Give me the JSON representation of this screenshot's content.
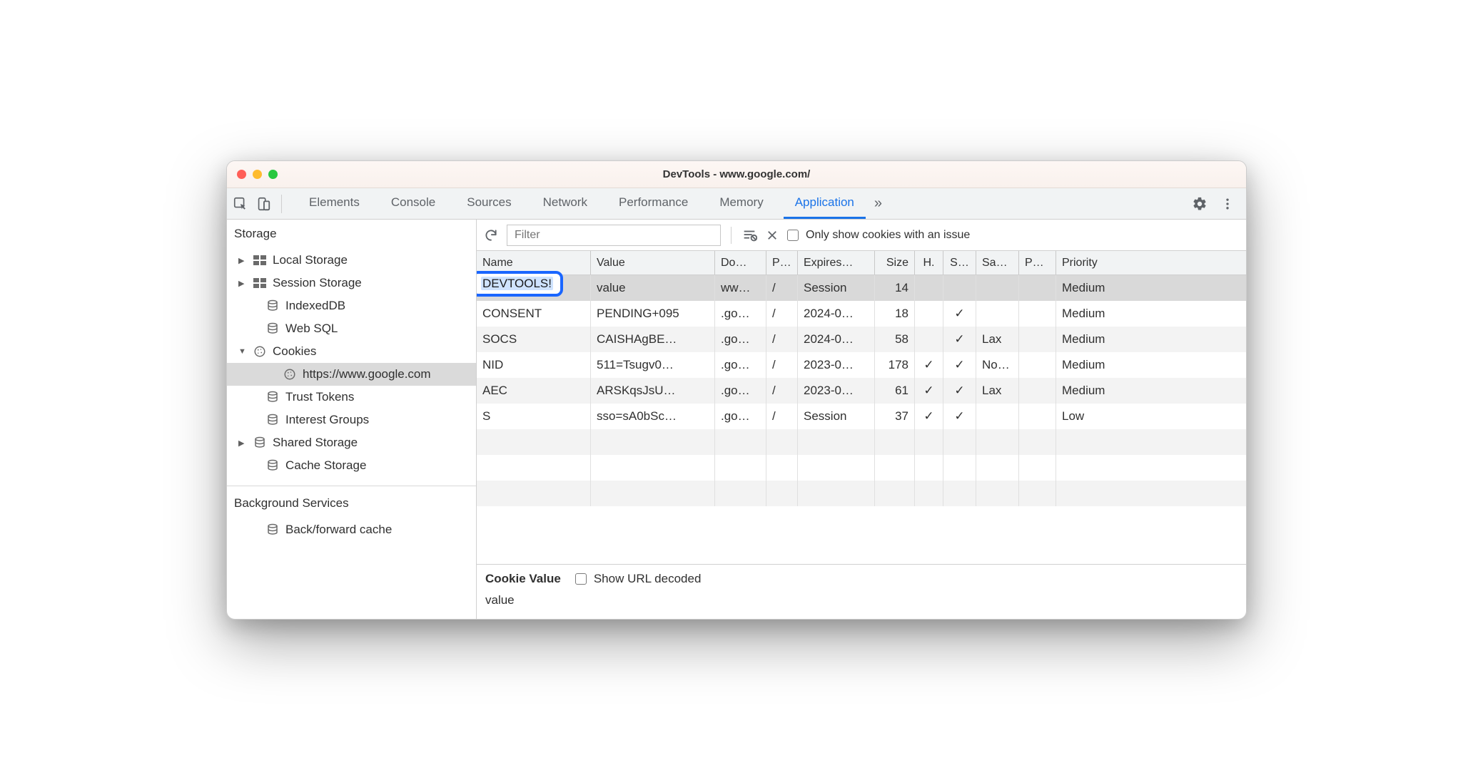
{
  "title": "DevTools - www.google.com/",
  "tabs": [
    "Elements",
    "Console",
    "Sources",
    "Network",
    "Performance",
    "Memory",
    "Application"
  ],
  "active_tab_index": 6,
  "sidebar": {
    "sections": [
      {
        "title": "Storage",
        "items": [
          {
            "arrow": "▶",
            "icon": "grid",
            "label": "Local Storage",
            "indent": 0
          },
          {
            "arrow": "▶",
            "icon": "grid",
            "label": "Session Storage",
            "indent": 0
          },
          {
            "arrow": "",
            "icon": "db",
            "label": "IndexedDB",
            "indent": 1
          },
          {
            "arrow": "",
            "icon": "db",
            "label": "Web SQL",
            "indent": 1
          },
          {
            "arrow": "▼",
            "icon": "cookie",
            "label": "Cookies",
            "indent": 0
          },
          {
            "arrow": "",
            "icon": "cookie",
            "label": "https://www.google.com",
            "indent": 2,
            "selected": true
          },
          {
            "arrow": "",
            "icon": "db",
            "label": "Trust Tokens",
            "indent": 1
          },
          {
            "arrow": "",
            "icon": "db",
            "label": "Interest Groups",
            "indent": 1
          },
          {
            "arrow": "▶",
            "icon": "db",
            "label": "Shared Storage",
            "indent": 0
          },
          {
            "arrow": "",
            "icon": "db",
            "label": "Cache Storage",
            "indent": 1
          }
        ]
      },
      {
        "title": "Background Services",
        "items": [
          {
            "arrow": "",
            "icon": "db",
            "label": "Back/forward cache",
            "indent": 1
          }
        ]
      }
    ]
  },
  "toolbar": {
    "filter_placeholder": "Filter",
    "only_issues_label": "Only show cookies with an issue"
  },
  "table": {
    "columns": [
      "Name",
      "Value",
      "Do…",
      "P…",
      "Expires…",
      "Size",
      "H.",
      "S…",
      "Sa…",
      "P…",
      "Priority"
    ],
    "editing_value": "DEVTOOLS!",
    "rows": [
      {
        "name": "",
        "value": "value",
        "domain": "ww…",
        "path": "/",
        "expires": "Session",
        "size": "14",
        "http": "",
        "secure": "",
        "samesite": "",
        "partition": "",
        "priority": "Medium",
        "selected": true
      },
      {
        "name": "CONSENT",
        "value": "PENDING+095",
        "domain": ".go…",
        "path": "/",
        "expires": "2024-0…",
        "size": "18",
        "http": "",
        "secure": "✓",
        "samesite": "",
        "partition": "",
        "priority": "Medium"
      },
      {
        "name": "SOCS",
        "value": "CAISHAgBE…",
        "domain": ".go…",
        "path": "/",
        "expires": "2024-0…",
        "size": "58",
        "http": "",
        "secure": "✓",
        "samesite": "Lax",
        "partition": "",
        "priority": "Medium"
      },
      {
        "name": "NID",
        "value": "511=Tsugv0…",
        "domain": ".go…",
        "path": "/",
        "expires": "2023-0…",
        "size": "178",
        "http": "✓",
        "secure": "✓",
        "samesite": "No…",
        "partition": "",
        "priority": "Medium"
      },
      {
        "name": "AEC",
        "value": "ARSKqsJsU…",
        "domain": ".go…",
        "path": "/",
        "expires": "2023-0…",
        "size": "61",
        "http": "✓",
        "secure": "✓",
        "samesite": "Lax",
        "partition": "",
        "priority": "Medium"
      },
      {
        "name": "S",
        "value": "sso=sA0bSc…",
        "domain": ".go…",
        "path": "/",
        "expires": "Session",
        "size": "37",
        "http": "✓",
        "secure": "✓",
        "samesite": "",
        "partition": "",
        "priority": "Low"
      }
    ]
  },
  "cookie_pane": {
    "heading": "Cookie Value",
    "show_decoded_label": "Show URL decoded",
    "value": "value"
  }
}
